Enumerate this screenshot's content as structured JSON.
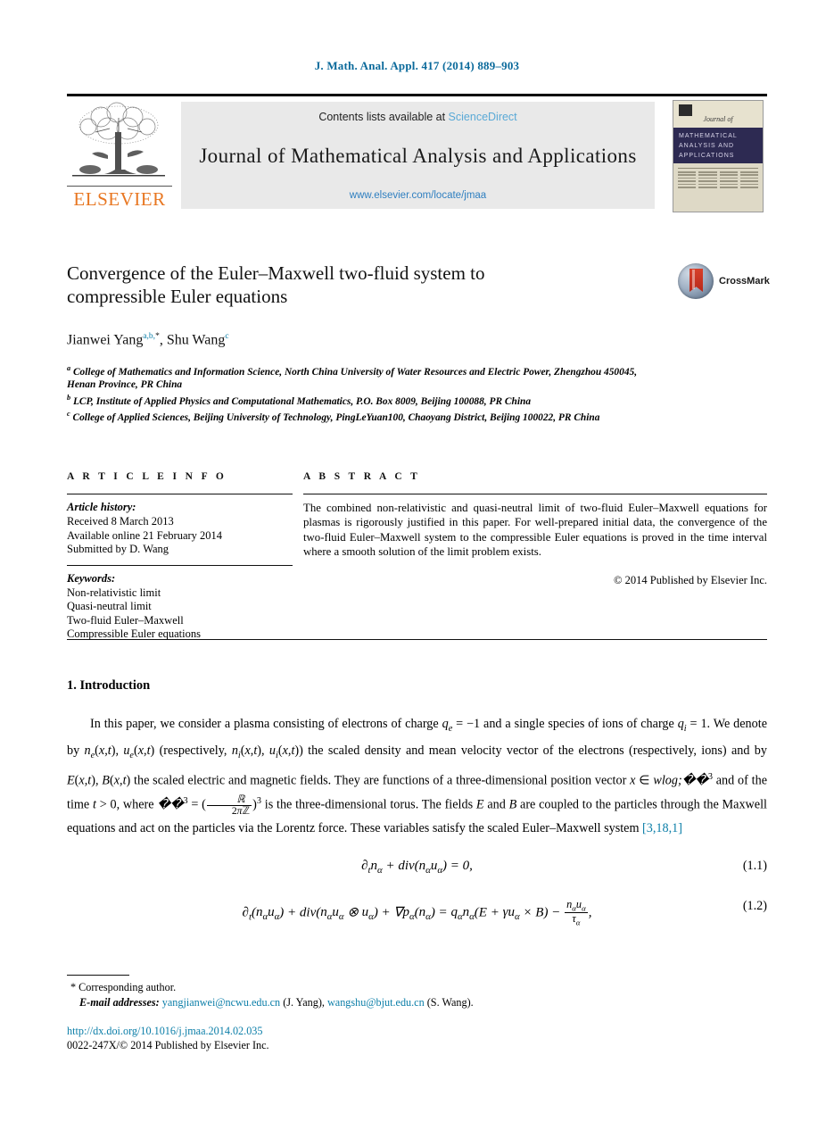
{
  "running_head": "J. Math. Anal. Appl. 417 (2014) 889–903",
  "masthead": {
    "contents_prefix": "Contents lists available at ",
    "sciencedirect": "ScienceDirect",
    "journal_title": "Journal of Mathematical Analysis and Applications",
    "journal_url": "www.elsevier.com/locate/jmaa",
    "publisher_word": "ELSEVIER",
    "cover": {
      "journal_of": "Journal of",
      "band_line1": "MATHEMATICAL",
      "band_line2": "ANALYSIS AND",
      "band_line3": "APPLICATIONS"
    }
  },
  "crossmark": {
    "label": "CrossMark"
  },
  "article": {
    "title_line1": "Convergence of the Euler–Maxwell two-fluid system to",
    "title_line2": "compressible Euler equations",
    "authors": [
      {
        "name": "Jianwei Yang",
        "sup": "a,b,",
        "star": "*"
      },
      {
        "name": "Shu Wang",
        "sup": "c",
        "star": ""
      }
    ],
    "affiliations": [
      {
        "marker": "a",
        "text": "College of Mathematics and Information Science, North China University of Water Resources and Electric Power, Zhengzhou 450045, Henan Province, PR China"
      },
      {
        "marker": "b",
        "text": "LCP, Institute of Applied Physics and Computational Mathematics, P.O. Box 8009, Beijing 100088, PR China"
      },
      {
        "marker": "c",
        "text": "College of Applied Sciences, Beijing University of Technology, PingLeYuan100, Chaoyang District, Beijing 100022, PR China"
      }
    ]
  },
  "info": {
    "heading": "A R T I C L E   I N F O",
    "history_label": "Article history:",
    "history": [
      "Received 8 March 2013",
      "Available online 21 February 2014",
      "Submitted by D. Wang"
    ],
    "keywords_label": "Keywords:",
    "keywords": [
      "Non-relativistic limit",
      "Quasi-neutral limit",
      "Two-fluid Euler–Maxwell",
      "Compressible Euler equations"
    ]
  },
  "abstract": {
    "heading": "A B S T R A C T",
    "text": "The combined non-relativistic and quasi-neutral limit of two-fluid Euler–Maxwell equations for plasmas is rigorously justified in this paper. For well-prepared initial data, the convergence of the two-fluid Euler–Maxwell system to the compressible Euler equations is proved in the time interval where a smooth solution of the limit problem exists.",
    "copyright": "© 2014 Published by Elsevier Inc."
  },
  "body": {
    "section_heading": "1.  Introduction",
    "citation": "[3,18,1]"
  },
  "equations": [
    {
      "number": "(1.1)"
    },
    {
      "number": "(1.2)"
    }
  ],
  "footnotes": {
    "corresponding": "*  Corresponding author.",
    "email_label": "E-mail addresses:",
    "email1": "yangjianwei@ncwu.edu.cn",
    "email1_owner": "(J. Yang),",
    "email2": "wangshu@bjut.edu.cn",
    "email2_owner": "(S. Wang)."
  },
  "footer": {
    "doi": "http://dx.doi.org/10.1016/j.jmaa.2014.02.035",
    "issn_line": "0022-247X/© 2014 Published by Elsevier Inc."
  },
  "colors": {
    "link_blue": "#0b7ea8",
    "sciencedirect_blue": "#5aa9d6",
    "elsevier_orange": "#e87722",
    "cover_band": "#2d2a52"
  }
}
